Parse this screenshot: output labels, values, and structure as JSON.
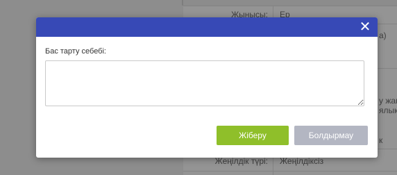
{
  "background": {
    "rows": [
      {
        "label": "Жынысы:",
        "value": "Ер"
      },
      {
        "label": "",
        "value": "а)"
      },
      {
        "label": "",
        "value": "у жан"
      },
      {
        "label": "",
        "value": "ялык"
      },
      {
        "label": "",
        "value": "к"
      },
      {
        "label": "Жеңілдік түрі:",
        "value": "Жеңілдіксіз"
      }
    ]
  },
  "modal": {
    "close_symbol": "✕",
    "field_label": "Бас тарту себебі:",
    "textarea_value": "",
    "send_label": "Жіберу",
    "cancel_label": "Болдырмау"
  },
  "colors": {
    "header": "#3749b6",
    "send": "#8fbf2a",
    "cancel": "#b3b6c2"
  }
}
